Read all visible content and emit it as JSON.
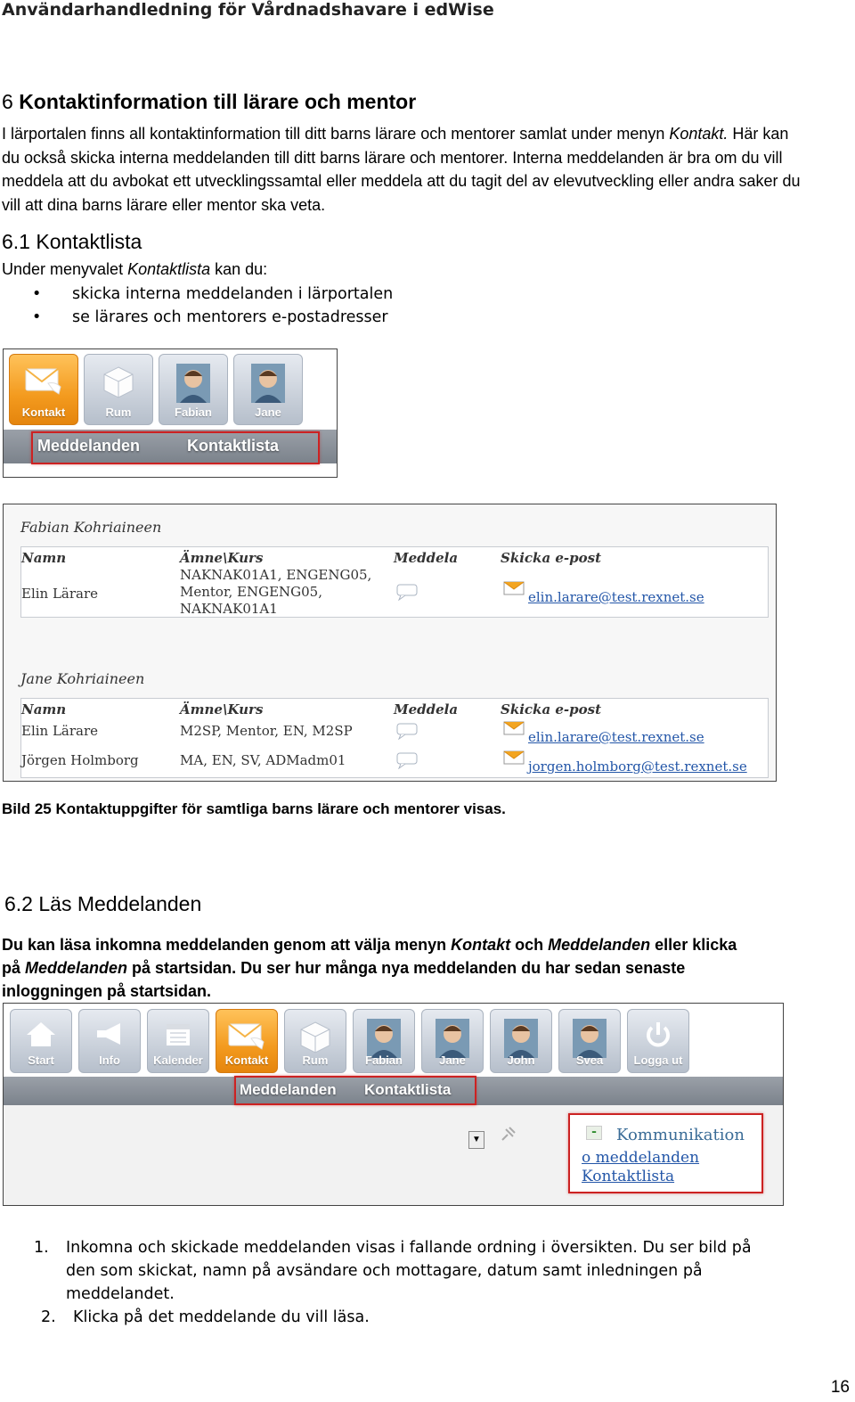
{
  "header": "Användarhandledning för Vårdnadshavare i edWise",
  "section6": {
    "number": "6",
    "title": "Kontaktinformation till lärare och mentor",
    "para": [
      {
        "t": "I lärportalen finns all kontaktinformation till ditt barns lärare och mentorer samlat under menyn "
      },
      {
        "t": "Kontakt.",
        "i": true
      },
      {
        "t": " Här kan du också skicka interna meddelanden till ditt barns lärare och mentorer. Interna meddelanden är bra om du vill meddela att du avbokat ett utvecklingssamtal eller meddela att du tagit del av elevutveckling eller andra saker du vill att dina barns lärare eller mentor ska veta."
      }
    ]
  },
  "section61": {
    "title": "6.1 Kontaktlista",
    "intro_a": "Under menyvalet ",
    "intro_i": "Kontaktlista",
    "intro_b": " kan du:",
    "bullet_char": "•",
    "bullets": [
      "skicka interna meddelanden i lärportalen",
      "se lärares och mentorers e-postadresser"
    ]
  },
  "menu1": {
    "tiles": [
      {
        "label": "Kontakt",
        "icon": "envelope-icon",
        "active": true
      },
      {
        "label": "Rum",
        "icon": "cube-icon"
      },
      {
        "label": "Fabian",
        "icon": "person-photo-icon"
      },
      {
        "label": "Jane",
        "icon": "person-photo-icon"
      }
    ],
    "sub": [
      "Meddelanden",
      "Kontaktlista"
    ]
  },
  "contacts": {
    "headers": [
      "Namn",
      "Ämne\\Kurs",
      "Meddela",
      "Skicka e-post"
    ],
    "groups": [
      {
        "name": "Fabian Kohriaineen",
        "rows": [
          {
            "name": "Elin Lärare",
            "subjects": [
              "NAKNAK01A1, ENGENG05,",
              "Mentor, ENGENG05,",
              "NAKNAK01A1"
            ],
            "email": "elin.larare@test.rexnet.se"
          }
        ]
      },
      {
        "name": "Jane Kohriaineen",
        "rows": [
          {
            "name": "Elin Lärare",
            "subjects": [
              "M2SP, Mentor, EN, M2SP"
            ],
            "email": "elin.larare@test.rexnet.se"
          },
          {
            "name": "Jörgen Holmborg",
            "subjects": [
              "MA, EN, SV, ADMadm01"
            ],
            "email": "jorgen.holmborg@test.rexnet.se"
          }
        ]
      }
    ]
  },
  "caption": "Bild 25 Kontaktuppgifter för samtliga barns lärare och mentorer visas.",
  "section62": {
    "title": "6.2 Läs Meddelanden",
    "para": [
      {
        "t": "Du kan läsa inkomna meddelanden genom att välja menyn "
      },
      {
        "t": "Kontakt",
        "i": true
      },
      {
        "t": " och "
      },
      {
        "t": "Meddelanden",
        "i": true
      },
      {
        "t": " eller klicka på "
      },
      {
        "t": "Meddelanden",
        "i": true
      },
      {
        "t": " på startsidan. Du ser hur många nya meddelanden du har sedan senaste inloggningen på startsidan."
      }
    ]
  },
  "menu2": {
    "tiles": [
      {
        "label": "Start",
        "icon": "house-icon"
      },
      {
        "label": "Info",
        "icon": "megaphone-icon"
      },
      {
        "label": "Kalender",
        "icon": "calendar-icon"
      },
      {
        "label": "Kontakt",
        "icon": "envelope-icon",
        "active": true
      },
      {
        "label": "Rum",
        "icon": "cube-icon"
      },
      {
        "label": "Fabian",
        "icon": "person-photo-icon"
      },
      {
        "label": "Jane",
        "icon": "person-photo-icon"
      },
      {
        "label": "John",
        "icon": "person-photo-icon"
      },
      {
        "label": "Svea",
        "icon": "person-photo-icon"
      },
      {
        "label": "Logga ut",
        "icon": "power-icon"
      }
    ],
    "sub": [
      "Meddelanden",
      "Kontaktlista"
    ],
    "widget": {
      "minus": "-",
      "title": "Kommunikation",
      "line1": "o meddelanden",
      "line2": "Kontaktlista"
    }
  },
  "steps": [
    {
      "n": "1.",
      "text": "Inkomna och skickade meddelanden visas i fallande ordning i översikten. Du ser bild på den som skickat, namn på avsändare och mottagare, datum samt inledningen på meddelandet."
    },
    {
      "n": "2.",
      "text": "Klicka på det meddelande du vill läsa."
    }
  ],
  "page_number": "16"
}
